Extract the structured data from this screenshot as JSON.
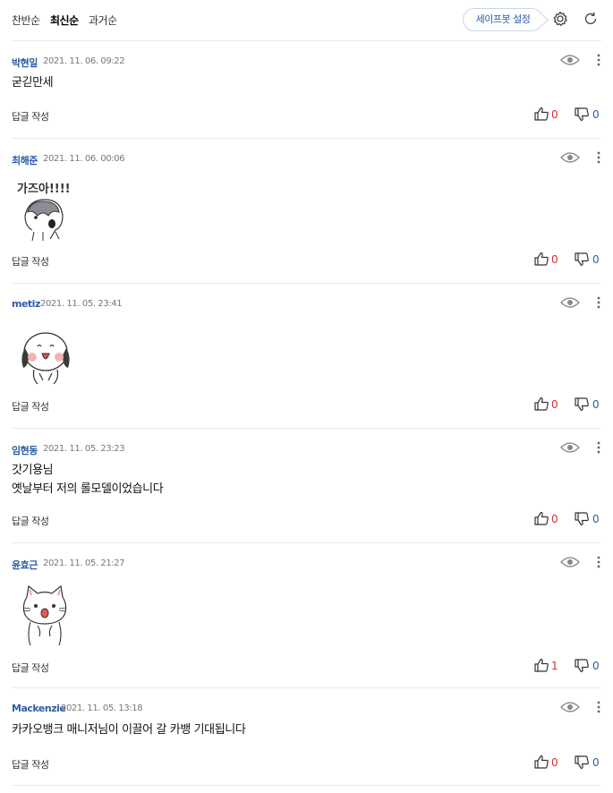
{
  "sort_tabs": [
    "찬반순",
    "최신순",
    "과거순"
  ],
  "safebot_label": "세이프봇 설정",
  "reply_label": "답글 작성",
  "sticker_text": "가즈아!!!!",
  "comments": [
    {
      "author": "박현일",
      "date": "2021. 11. 06. 09:22",
      "text": [
        "굳긷만세"
      ],
      "likes": "0",
      "dislikes": "0"
    },
    {
      "author": "최해준",
      "date": "2021. 11. 06. 00:06",
      "sticker": "dog-gazua-sticker",
      "likes": "0",
      "dislikes": "0"
    },
    {
      "author": "metiz",
      "date": "2021. 11. 05. 23:41",
      "sticker": "dog-happy-sticker",
      "likes": "0",
      "dislikes": "0"
    },
    {
      "author": "임현동",
      "date": "2021. 11. 05. 23:23",
      "text": [
        "갓기용님",
        "옛날부터 저의 롤모델이었습니다"
      ],
      "likes": "0",
      "dislikes": "0"
    },
    {
      "author": "윤효근",
      "date": "2021. 11. 05. 21:27",
      "sticker": "cat-surprised-sticker",
      "likes": "1",
      "dislikes": "0"
    },
    {
      "author": "Mackenzie",
      "date": "2021. 11. 05. 13:18",
      "text": [
        "카카오뱅크 매니저님이 이끌어 갈 카뱅 기대됩니다"
      ],
      "likes": "0",
      "dislikes": "0"
    }
  ],
  "colors": {
    "author": "#2e5ea6",
    "like": "#d6302c",
    "dislike": "#2e5ea6"
  }
}
